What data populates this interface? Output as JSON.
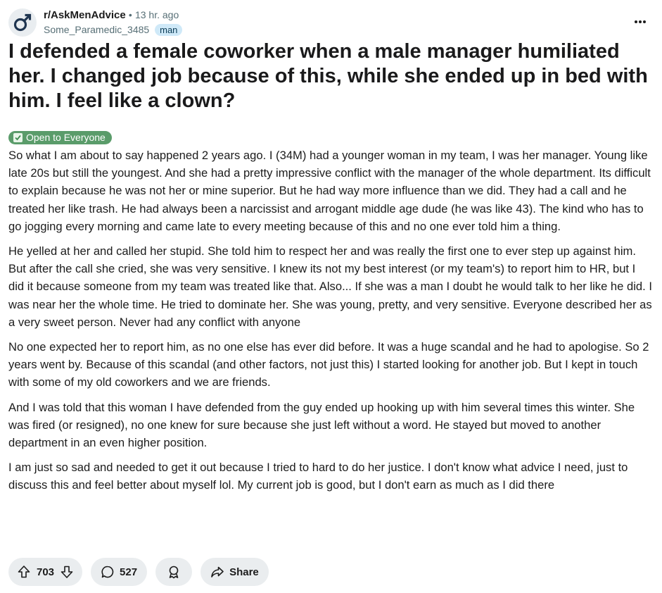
{
  "post": {
    "subreddit": "r/AskMenAdvice",
    "separator": "•",
    "time_ago": "13 hr. ago",
    "author": "Some_Paramedic_3485",
    "author_flair": "man",
    "title": "I defended a female coworker when a male manager humiliated her. I changed job because of this, while she ended up in bed with him. I feel like a clown?",
    "flair": "Open to Everyone",
    "paragraphs": [
      "So what I am about to say happened 2 years ago. I (34M) had a younger woman in my team, I was her manager. Young like late 20s but still the youngest. And she had a pretty impressive conflict with the manager of the whole department. Its difficult to explain because he was not her or mine superior. But he had way more influence than we did. They had a call and he treated her like trash. He had always been a narcissist and arrogant middle age dude (he was like 43). The kind who has to go jogging every morning and came late to every meeting because of this and no one ever told him a thing.",
      "He yelled at her and called her stupid. She told him to respect her and was really the first one to ever step up against him. But after the call she cried, she was very sensitive. I knew its not my best interest (or my team's) to report him to HR, but I did it because someone from my team was treated like that. Also... If she was a man I doubt he would talk to her like he did. I was near her the whole time. He tried to dominate her. She was young, pretty, and very sensitive. Everyone described her as a very sweet person. Never had any conflict with anyone",
      "No one expected her to report him, as no one else has ever did before. It was a huge scandal and he had to apologise. So 2 years went by. Because of this scandal (and other factors, not just this) I started looking for another job. But I kept in touch with some of my old coworkers and we are friends.",
      "And I was told that this woman I have defended from the guy ended up hooking up with him several times this winter. She was fired (or resigned), no one knew for sure because she just left without a word. He stayed but moved to another department in an even higher position.",
      "I am just so sad and needed to get it out because I tried to hard to do her justice. I don't know what advice I need, just to discuss this and feel better about myself lol. My current job is good, but I don't earn as much as I did there"
    ]
  },
  "actions": {
    "upvotes": "703",
    "comments": "527",
    "share_label": "Share"
  },
  "icons": {
    "avatar": "subreddit-male-symbol-icon",
    "overflow": "ellipsis-icon",
    "flair": "checkbox-icon",
    "upvote": "arrow-up-icon",
    "downvote": "arrow-down-icon",
    "comment": "speech-bubble-icon",
    "award": "award-icon",
    "share": "share-arrow-icon"
  },
  "colors": {
    "flair_bg": "#5a9c6a",
    "user_flair_bg": "#cfe9f8",
    "pill_bg": "#eaedef"
  }
}
